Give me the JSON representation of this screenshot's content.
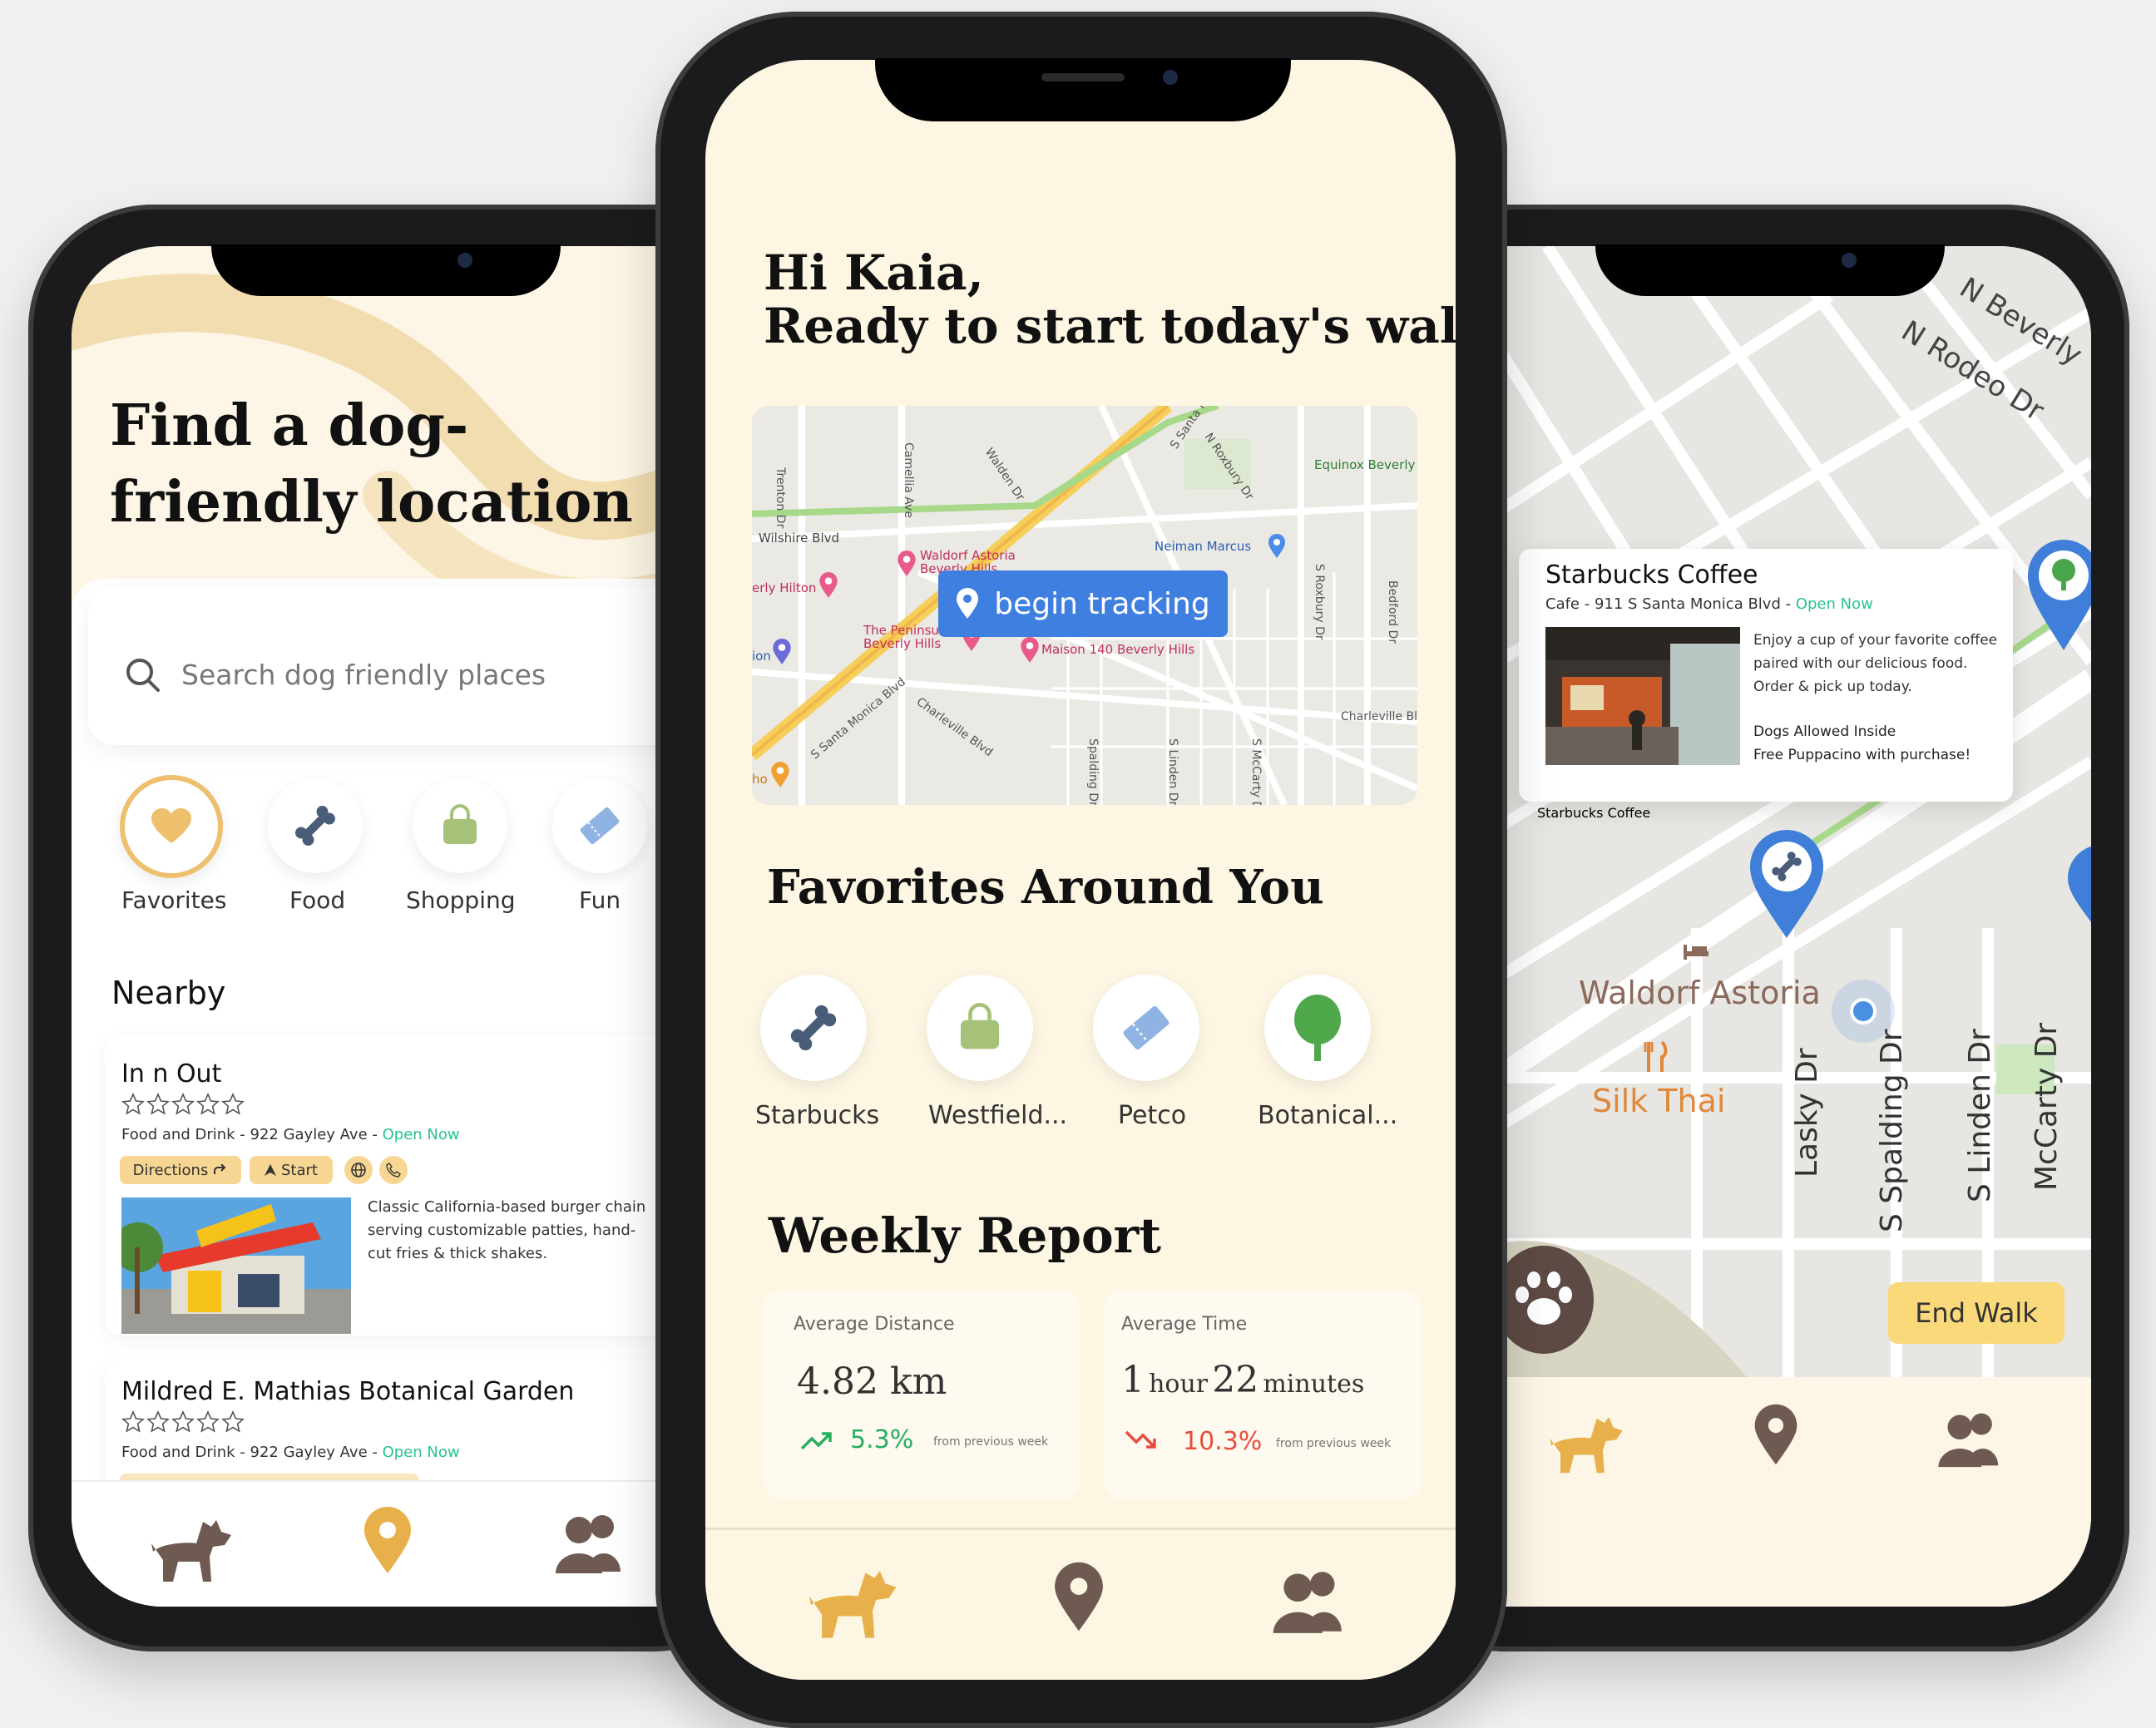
{
  "left": {
    "title": "Find a dog-friendly location",
    "search_placeholder": "Search dog friendly places",
    "categories": [
      {
        "label": "Favorites",
        "icon": "heart-icon"
      },
      {
        "label": "Food",
        "icon": "bone-icon"
      },
      {
        "label": "Shopping",
        "icon": "bag-icon"
      },
      {
        "label": "Fun",
        "icon": "ticket-icon"
      }
    ],
    "nearby_heading": "Nearby",
    "places": [
      {
        "name": "In n Out",
        "meta": "Food and Drink - 922 Gayley Ave - ",
        "status": "Open Now",
        "directions": "Directions",
        "start": "Start",
        "description": "Classic California-based burger chain serving customizable patties, hand-cut fries & thick shakes.",
        "image": "in-n-out-photo"
      },
      {
        "name": "Mildred E. Mathias Botanical Garden",
        "meta": "Food and Drink - 922 Gayley Ave - ",
        "status": "Open Now"
      }
    ]
  },
  "center": {
    "greeting_line1": "Hi Kaia,",
    "greeting_line2": "Ready to start today's walk?",
    "map_button": "begin tracking",
    "map_labels": {
      "wilshire": "Wilshire Blvd",
      "waldorf": "Waldorf Astoria Beverly Hills",
      "hilton": "erly Hilton",
      "peninsula": "The Peninsula Beverly Hills",
      "maison": "Maison 140 Beverly Hills",
      "neiman": "Neiman Marcus",
      "equinox": "Equinox Beverly",
      "santa_monica": "S Santa Monica Blvd",
      "charleville": "Charleville Blvd",
      "charleville2": "Charleville Bl",
      "trenton": "Trenton Dr",
      "camelia": "Camellia Ave",
      "walden": "Walden Dr",
      "roxbury": "N Roxbury Dr",
      "s_roxbury": "S Roxbury Dr",
      "bedford": "Bedford Dr",
      "spalding": "Spalding Dr",
      "linden": "S Linden Dr",
      "mccarty": "S McCarty Dr",
      "santa_mon_top": "S Santa Mon",
      "lion": "ion",
      "ho": "ho"
    },
    "favorites_heading": "Favorites Around You",
    "favorites": [
      {
        "label": "Starbucks",
        "icon": "bone-icon"
      },
      {
        "label": "Westfield...",
        "icon": "bag-icon"
      },
      {
        "label": "Petco",
        "icon": "ticket-icon"
      },
      {
        "label": "Botanical...",
        "icon": "tree-icon"
      }
    ],
    "report_heading": "Weekly Report",
    "stats": [
      {
        "label": "Average Distance",
        "value": "4.82 km",
        "change": "5.3%",
        "note": "from previous week",
        "trend": "up",
        "color": "#27ae60"
      },
      {
        "label": "Average Time",
        "value_num1": "1",
        "value_unit1": "hour",
        "value_num2": "22",
        "value_unit2": "minutes",
        "change": "10.3%",
        "note": "from previous week",
        "trend": "down",
        "color": "#e74c3c"
      }
    ]
  },
  "right": {
    "card_title": "Starbucks Coffee",
    "card_meta": "Cafe - 911 S Santa Monica Blvd - ",
    "card_status": "Open Now",
    "card_desc": "Enjoy a cup of your favorite coffee paired with our delicious food. Order & pick up today.",
    "card_extra1": "Dogs Allowed Inside",
    "card_extra2": "Free Puppacino with purchase!",
    "map_labels": {
      "beverly": "N Beverly",
      "rodeo": "N Rodeo Dr",
      "waldorf": "Waldorf Astoria",
      "silk_thai": "Silk Thai",
      "lasky": "Lasky Dr",
      "spalding": "S Spalding Dr",
      "linden": "S Linden Dr",
      "mccarty": "McCarty Dr",
      "dr": "Dr",
      "on": "on"
    },
    "end_walk": "End Walk"
  },
  "colors": {
    "accent": "#e8b04a",
    "cream": "#fdf6e3",
    "brown": "#6f5a52",
    "slate": "#4a5d78",
    "green": "#27c490"
  }
}
